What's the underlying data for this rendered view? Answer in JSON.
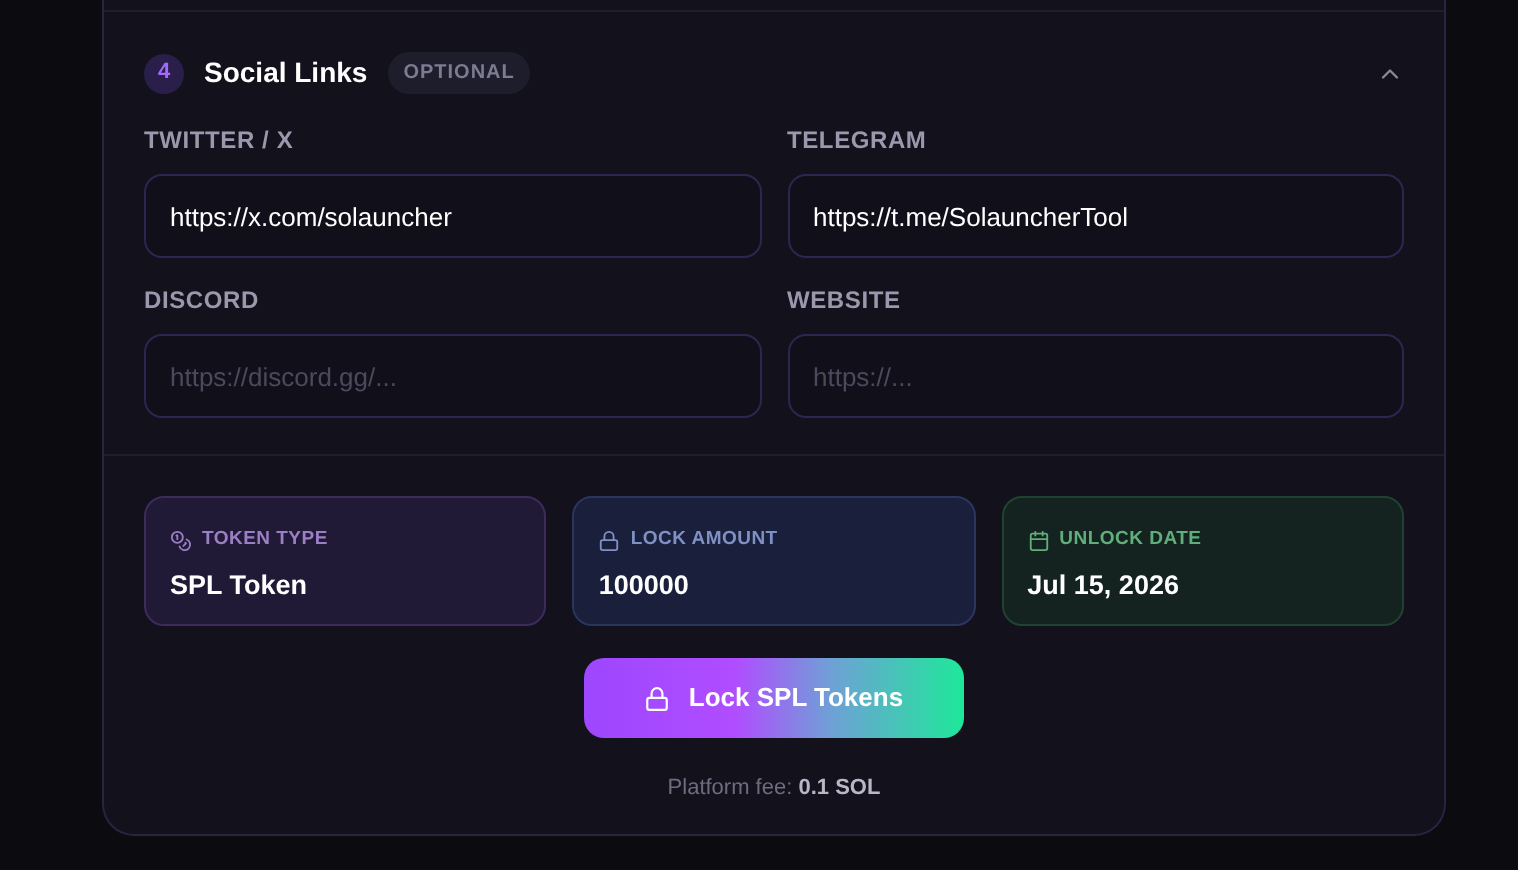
{
  "section": {
    "number": "4",
    "title": "Social Links",
    "badge": "OPTIONAL",
    "expanded": true,
    "fields": [
      {
        "label": "TWITTER / X",
        "value": "https://x.com/solauncher"
      },
      {
        "label": "TELEGRAM",
        "value": "https://t.me/SolauncherTool"
      },
      {
        "label": "DISCORD",
        "placeholder": "https://discord.gg/..."
      },
      {
        "label": "WEBSITE",
        "placeholder": "https://..."
      }
    ]
  },
  "summary": [
    {
      "kind": "token",
      "label": "TOKEN TYPE",
      "value": "SPL Token"
    },
    {
      "kind": "amount",
      "label": "LOCK AMOUNT",
      "value": "100000"
    },
    {
      "kind": "date",
      "label": "UNLOCK DATE",
      "value": "Jul 15, 2026"
    }
  ],
  "submit": "Lock SPL Tokens",
  "fee": "Platform fee: **0.1 SOL**"
}
